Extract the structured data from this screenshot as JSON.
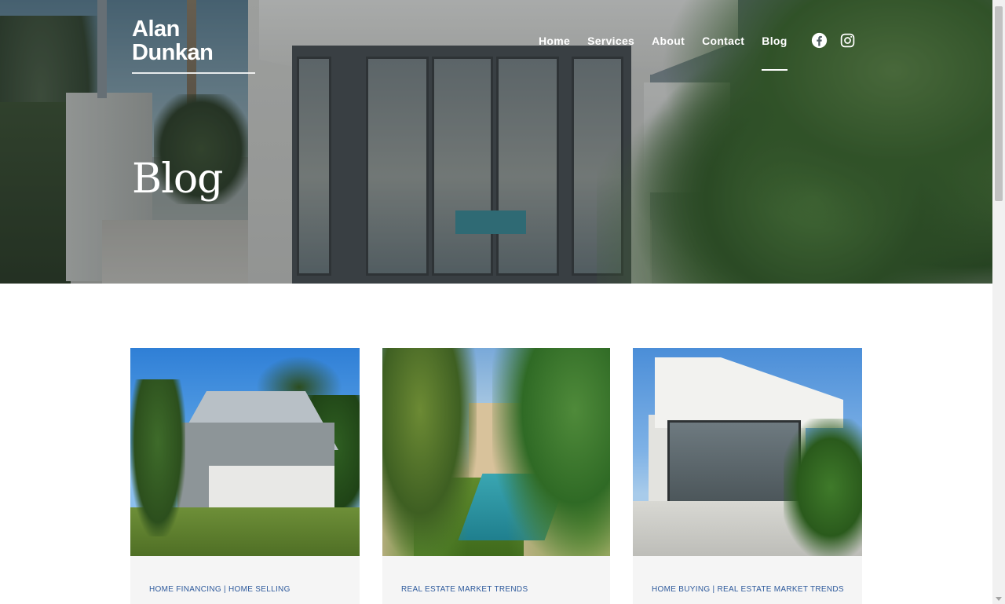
{
  "site": {
    "logo_line1": "Alan",
    "logo_line2": "Dunkan"
  },
  "nav": {
    "items": [
      {
        "label": "Home",
        "active": false
      },
      {
        "label": "Services",
        "active": false
      },
      {
        "label": "About",
        "active": false
      },
      {
        "label": "Contact",
        "active": false
      },
      {
        "label": "Blog",
        "active": true
      }
    ]
  },
  "social": {
    "icons": [
      "facebook-icon",
      "instagram-icon"
    ]
  },
  "hero": {
    "title": "Blog"
  },
  "posts": [
    {
      "image": "house-with-gabled-roof",
      "categories": "HOME FINANCING | HOME SELLING"
    },
    {
      "image": "pool-courtyard-with-palms",
      "categories": "REAL ESTATE MARKET TRENDS"
    },
    {
      "image": "modern-house-with-glass-doors",
      "categories": "HOME BUYING | REAL ESTATE MARKET TRENDS"
    }
  ],
  "colors": {
    "category_text": "#2e5a9c",
    "card_background": "#f5f5f5",
    "nav_text": "#ffffff"
  }
}
